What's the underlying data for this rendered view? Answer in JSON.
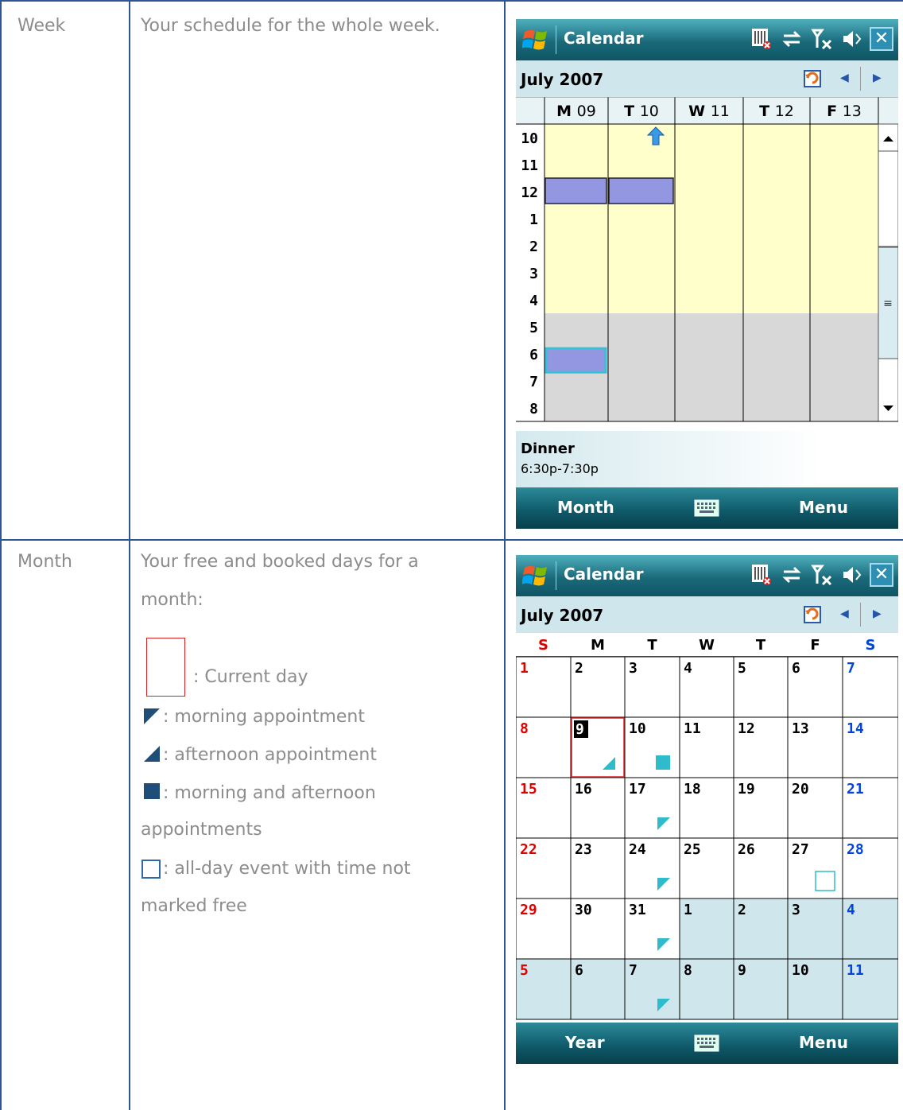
{
  "rows": [
    {
      "label": "Week",
      "description": "Your schedule for the whole week."
    },
    {
      "label": "Month",
      "description_lines": [
        "Your free and booked days for a",
        "month:"
      ]
    }
  ],
  "legend": [
    {
      "icon": "current-day-box-icon",
      "text": ": Current day"
    },
    {
      "icon": "morning-appointment-icon",
      "text": ": morning appointment"
    },
    {
      "icon": "afternoon-appointment-icon",
      "text": ": afternoon appointment"
    },
    {
      "icon": "morning-afternoon-icon",
      "text_lines": [
        ": morning and afternoon",
        "appointments"
      ]
    },
    {
      "icon": "all-day-event-icon",
      "text_lines": [
        ": all-day event with time not",
        "marked free"
      ]
    }
  ],
  "colors": {
    "border": "#2f5597",
    "accent": "#2b7a8b",
    "appointment": "#9397e2",
    "work_hours": "#ffffcc",
    "off_hours": "#d8d8d8",
    "marker": "#2ebccc"
  },
  "week_screen": {
    "title": "Calendar",
    "month": "July 2007",
    "days": [
      {
        "abbr": "M",
        "num": "09"
      },
      {
        "abbr": "T",
        "num": "10"
      },
      {
        "abbr": "W",
        "num": "11"
      },
      {
        "abbr": "T",
        "num": "12"
      },
      {
        "abbr": "F",
        "num": "13"
      }
    ],
    "hours": [
      "10",
      "11",
      "12",
      "1",
      "2",
      "3",
      "4",
      "5",
      "6",
      "7",
      "8"
    ],
    "appointment": {
      "title": "Dinner",
      "time": "6:30p-7:30p"
    },
    "softkey_left": "Month",
    "softkey_right": "Menu"
  },
  "month_screen": {
    "title": "Calendar",
    "month": "July 2007",
    "weekday_letters": [
      "S",
      "M",
      "T",
      "W",
      "T",
      "F",
      "S"
    ],
    "weeks": [
      [
        "1",
        "2",
        "3",
        "4",
        "5",
        "6",
        "7"
      ],
      [
        "8",
        "9",
        "10",
        "11",
        "12",
        "13",
        "14"
      ],
      [
        "15",
        "16",
        "17",
        "18",
        "19",
        "20",
        "21"
      ],
      [
        "22",
        "23",
        "24",
        "25",
        "26",
        "27",
        "28"
      ],
      [
        "29",
        "30",
        "31",
        "1",
        "2",
        "3",
        "4"
      ],
      [
        "5",
        "6",
        "7",
        "8",
        "9",
        "10",
        "11"
      ]
    ],
    "softkey_left": "Year",
    "softkey_right": "Menu"
  }
}
